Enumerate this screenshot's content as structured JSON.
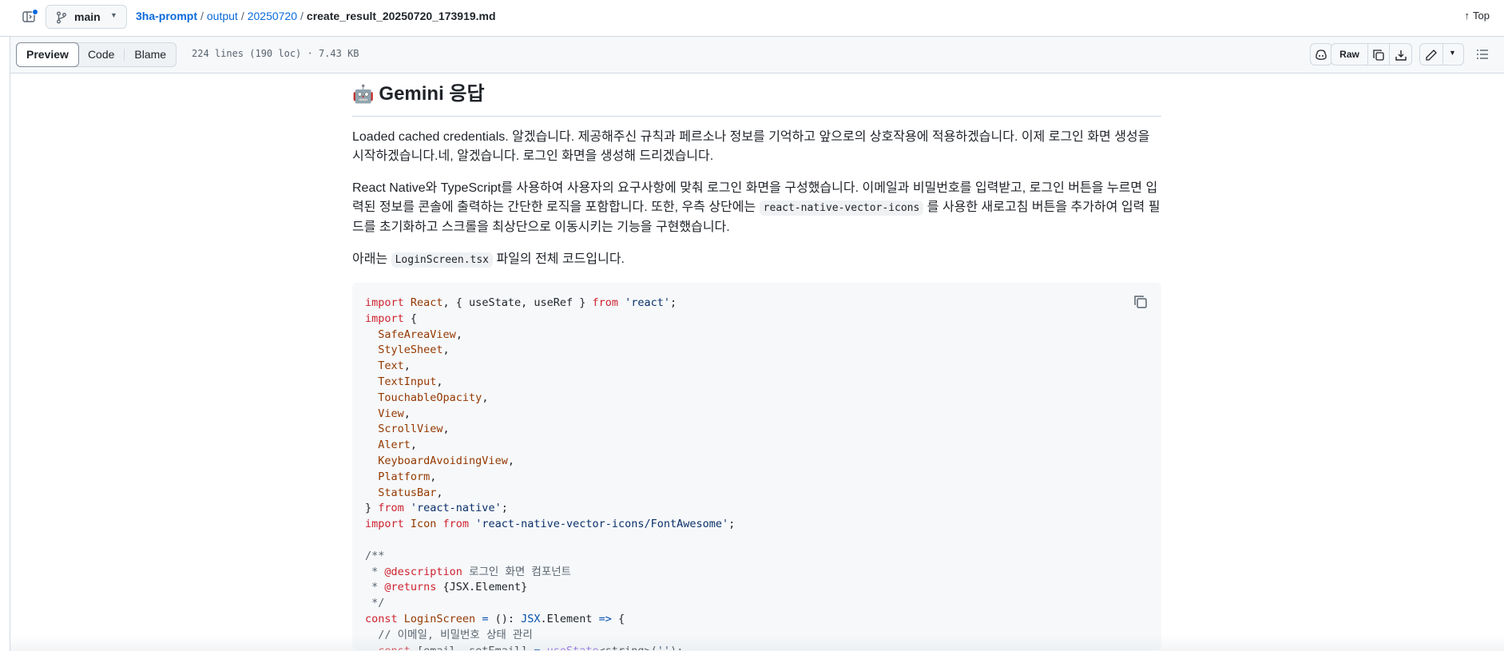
{
  "topbar": {
    "branch": "main",
    "breadcrumb": {
      "repo": "3ha-prompt",
      "dir1": "output",
      "dir2": "20250720",
      "file": "create_result_20250720_173919.md",
      "sep": "/"
    },
    "top_link": "Top"
  },
  "toolbar": {
    "tabs": [
      "Preview",
      "Code",
      "Blame"
    ],
    "active_tab": "Preview",
    "file_info": "224 lines (190 loc) · 7.43 KB",
    "raw_label": "Raw"
  },
  "content": {
    "heading": "Gemini 응답",
    "heading_icon": "robot-emoji",
    "p1": "Loaded cached credentials. 알겠습니다. 제공해주신 규칙과 페르소나 정보를 기억하고 앞으로의 상호작용에 적용하겠습니다. 이제 로그인 화면 생성을 시작하겠습니다.네, 알겠습니다. 로그인 화면을 생성해 드리겠습니다.",
    "p2_a": "React Native와 TypeScript를 사용하여 사용자의 요구사항에 맞춰 로그인 화면을 구성했습니다. 이메일과 비밀번호를 입력받고, 로그인 버튼을 누르면 입력된 정보를 콘솔에 출력하는 간단한 로직을 포함합니다. 또한, 우측 상단에는 ",
    "p2_code": "react-native-vector-icons",
    "p2_b": " 를 사용한 새로고침 버튼을 추가하여 입력 필드를 초기화하고 스크롤을 최상단으로 이동시키는 기능을 구현했습니다.",
    "p3_a": "아래는 ",
    "p3_code": "LoginScreen.tsx",
    "p3_b": " 파일의 전체 코드입니다.",
    "code_lines": [
      [
        [
          "kw",
          "import "
        ],
        [
          "typ",
          "React"
        ],
        [
          "",
          ""
        ],
        [
          "",
          ", { useState, useRef } "
        ],
        [
          "kw",
          "from "
        ],
        [
          "str",
          "'react'"
        ],
        [
          "",
          ";"
        ]
      ],
      [
        [
          "kw",
          "import "
        ],
        [
          "",
          "{"
        ]
      ],
      [
        [
          "",
          "  "
        ],
        [
          "typ",
          "SafeAreaView"
        ],
        [
          "",
          ","
        ]
      ],
      [
        [
          "",
          "  "
        ],
        [
          "typ",
          "StyleSheet"
        ],
        [
          "",
          ","
        ]
      ],
      [
        [
          "",
          "  "
        ],
        [
          "typ",
          "Text"
        ],
        [
          "",
          ","
        ]
      ],
      [
        [
          "",
          "  "
        ],
        [
          "typ",
          "TextInput"
        ],
        [
          "",
          ","
        ]
      ],
      [
        [
          "",
          "  "
        ],
        [
          "typ",
          "TouchableOpacity"
        ],
        [
          "",
          ","
        ]
      ],
      [
        [
          "",
          "  "
        ],
        [
          "typ",
          "View"
        ],
        [
          "",
          ","
        ]
      ],
      [
        [
          "",
          "  "
        ],
        [
          "typ",
          "ScrollView"
        ],
        [
          "",
          ","
        ]
      ],
      [
        [
          "",
          "  "
        ],
        [
          "typ",
          "Alert"
        ],
        [
          "",
          ","
        ]
      ],
      [
        [
          "",
          "  "
        ],
        [
          "typ",
          "KeyboardAvoidingView"
        ],
        [
          "",
          ","
        ]
      ],
      [
        [
          "",
          "  "
        ],
        [
          "typ",
          "Platform"
        ],
        [
          "",
          ","
        ]
      ],
      [
        [
          "",
          "  "
        ],
        [
          "typ",
          "StatusBar"
        ],
        [
          "",
          ","
        ]
      ],
      [
        [
          "",
          "} "
        ],
        [
          "kw",
          "from "
        ],
        [
          "str",
          "'react-native'"
        ],
        [
          "",
          ";"
        ]
      ],
      [
        [
          "kw",
          "import "
        ],
        [
          "typ",
          "Icon "
        ],
        [
          "kw",
          "from "
        ],
        [
          "str",
          "'react-native-vector-icons/FontAwesome'"
        ],
        [
          "",
          ";"
        ]
      ],
      [
        [
          "",
          ""
        ]
      ],
      [
        [
          "cm",
          "/**"
        ]
      ],
      [
        [
          "cm",
          " * "
        ],
        [
          "kw",
          "@description"
        ],
        [
          "cm",
          " 로그인 화면 컴포넌트"
        ]
      ],
      [
        [
          "cm",
          " * "
        ],
        [
          "kw",
          "@returns"
        ],
        [
          "",
          " {JSX.Element}"
        ]
      ],
      [
        [
          "cm",
          " */"
        ]
      ],
      [
        [
          "kw",
          "const "
        ],
        [
          "typ",
          "LoginScreen "
        ],
        [
          "blu",
          "= "
        ],
        [
          "",
          "(): "
        ],
        [
          "blu",
          "JSX"
        ],
        [
          "",
          ".Element "
        ],
        [
          "blu",
          "=> "
        ],
        [
          "",
          "{"
        ]
      ],
      [
        [
          "cm",
          "  // 이메일, 비밀번호 상태 관리"
        ]
      ],
      [
        [
          "kw",
          "  const "
        ],
        [
          "",
          "[email, setEmail] "
        ],
        [
          "blu",
          "= "
        ],
        [
          "fn",
          "useState"
        ],
        [
          "",
          "<string>("
        ],
        [
          "str",
          "''"
        ],
        [
          "",
          ");"
        ]
      ]
    ]
  }
}
